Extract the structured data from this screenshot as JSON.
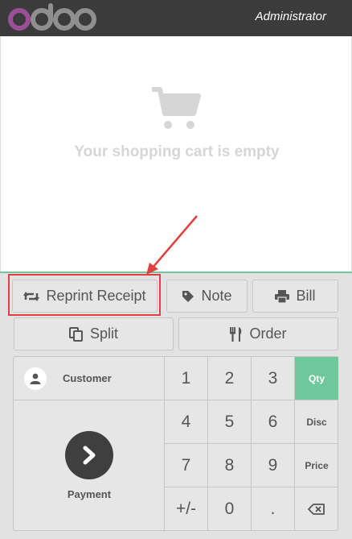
{
  "header": {
    "logo_text": "odoo",
    "user": "Administrator"
  },
  "cart": {
    "empty_message": "Your shopping cart is empty",
    "icon": "shopping-cart-icon"
  },
  "actions": {
    "reprint": "Reprint Receipt",
    "note": "Note",
    "bill": "Bill",
    "split": "Split",
    "order": "Order"
  },
  "numpad": {
    "customer": "Customer",
    "payment": "Payment",
    "keys": [
      [
        "1",
        "2",
        "3",
        "Qty"
      ],
      [
        "4",
        "5",
        "6",
        "Disc"
      ],
      [
        "7",
        "8",
        "9",
        "Price"
      ],
      [
        "+/-",
        "0",
        ".",
        ""
      ]
    ],
    "active_mode": "Qty"
  },
  "colors": {
    "topbar": "#3b3b3b",
    "accent": "#6ec89b",
    "logo_purple": "#9b4f96",
    "logo_gray": "#8f8f8f",
    "annotation": "#e04040"
  }
}
